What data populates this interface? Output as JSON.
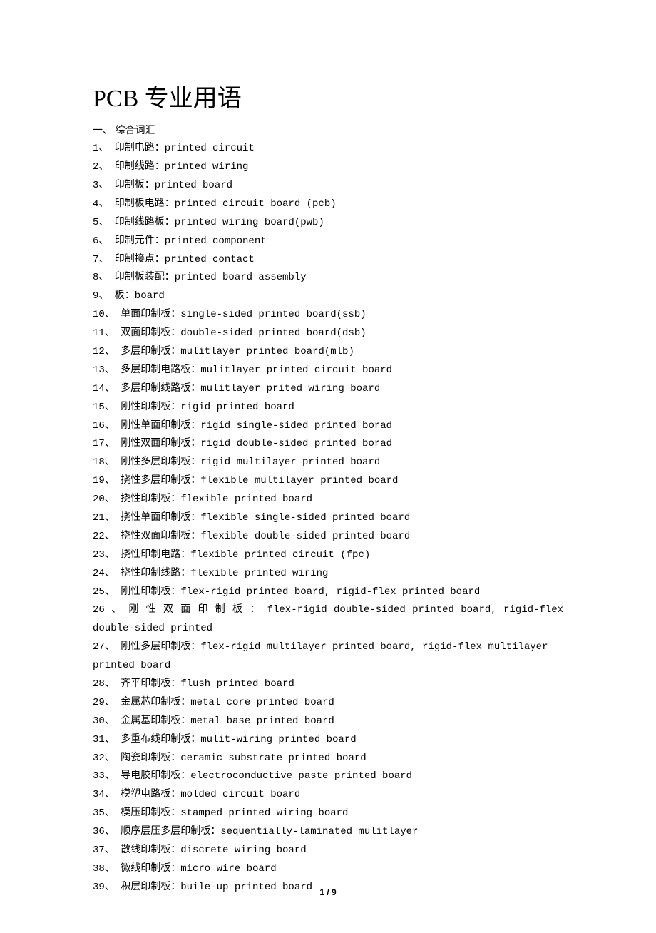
{
  "title": "PCB 专业用语",
  "section_header": "一、 综合词汇",
  "items": [
    "1、 印制电路：printed circuit",
    "2、 印制线路：printed wiring",
    "3、 印制板：printed board",
    "4、 印制板电路：printed circuit board (pcb)",
    "5、 印制线路板：printed wiring board(pwb)",
    "6、 印制元件：printed component",
    "7、 印制接点：printed contact",
    "8、 印制板装配：printed board assembly",
    "9、 板：board",
    "10、 单面印制板：single-sided printed board(ssb)",
    "11、 双面印制板：double-sided printed board(dsb)",
    "12、 多层印制板：mulitlayer printed board(mlb)",
    "13、 多层印制电路板：mulitlayer printed circuit board",
    "14、 多层印制线路板：mulitlayer prited wiring board",
    "15、 刚性印制板：rigid printed board",
    "16、 刚性单面印制板：rigid single-sided printed borad",
    "17、 刚性双面印制板：rigid double-sided printed borad",
    "18、 刚性多层印制板：rigid multilayer printed board",
    "19、 挠性多层印制板：flexible multilayer printed board",
    "20、 挠性印制板：flexible printed board",
    "21、 挠性单面印制板：flexible single-sided printed board",
    "22、 挠性双面印制板：flexible double-sided printed board",
    "23、 挠性印制电路：flexible printed circuit (fpc)",
    "24、 挠性印制线路：flexible printed wiring",
    "25、 刚性印制板：flex-rigid printed board, rigid-flex printed board",
    "26 、 刚 性 双 面 印 制 板 ： flex-rigid double-sided printed board, rigid-flex double-sided printed",
    "27、 刚性多层印制板：flex-rigid multilayer printed board, rigid-flex multilayer printed board",
    "28、 齐平印制板：flush printed board",
    "29、 金属芯印制板：metal core printed board",
    "30、 金属基印制板：metal base printed board",
    "31、 多重布线印制板：mulit-wiring printed board",
    "32、 陶瓷印制板：ceramic substrate printed board",
    "33、 导电胶印制板：electroconductive paste printed board",
    "34、 模塑电路板：molded circuit board",
    "35、 模压印制板：stamped printed wiring board",
    "36、 顺序层压多层印制板：sequentially-laminated mulitlayer",
    "37、 散线印制板：discrete wiring board",
    "38、 微线印制板：micro wire board",
    "39、 积层印制板：buile-up printed board"
  ],
  "page_number": "1 / 9"
}
